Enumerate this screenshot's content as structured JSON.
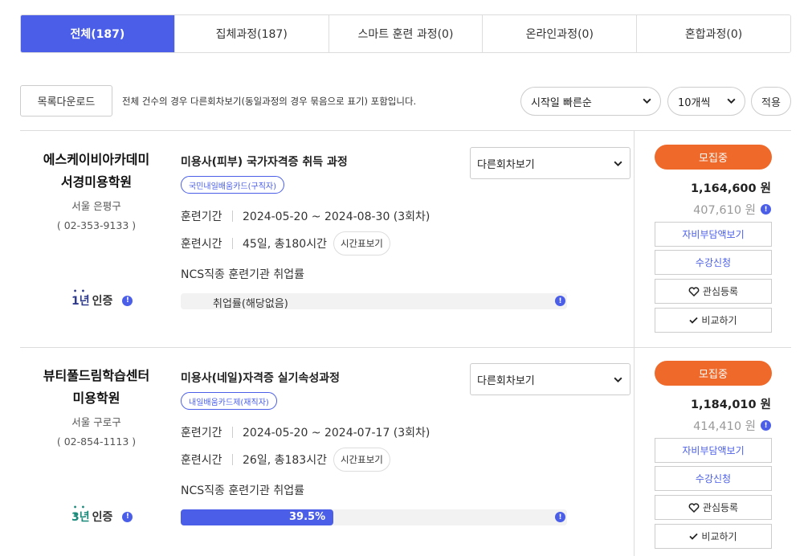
{
  "tabs": [
    {
      "label": "전체(187)",
      "active": true
    },
    {
      "label": "집체과정(187)",
      "active": false
    },
    {
      "label": "스마트 훈련 과정(0)",
      "active": false
    },
    {
      "label": "온라인과정(0)",
      "active": false
    },
    {
      "label": "혼합과정(0)",
      "active": false
    }
  ],
  "toolbar": {
    "download_label": "목록다운로드",
    "note": "전체 건수의 경우 다른회차보기(동일과정의 경우 묶음으로 표기) 포함입니다.",
    "sort_value": "시작일 빠른순",
    "count_value": "10개씩",
    "apply_label": "적용"
  },
  "courses": [
    {
      "inst_line1": "에스케이비아카데미",
      "inst_line2": "서경미용학원",
      "location": "서울 은평구",
      "tel": "( 02-353-9133 )",
      "cert_years": "1년",
      "cert_label": "인증",
      "title": "미용사(피부) 국가자격증 취득 과정",
      "badge": "국민내일배움카드(구직자)",
      "rerun": "다른회차보기",
      "period_label": "훈련기간",
      "period": "2024-05-20 ~ 2024-08-30 (3회차)",
      "time_label": "훈련시간",
      "time": "45일, 총180시간",
      "timetable": "시간표보기",
      "ncs": "NCS직종 훈련기관 취업률",
      "rate_text": "취업률(해당없음)",
      "rate": 0,
      "status": "모집중",
      "price": "1,164,600 원",
      "self_pay": "407,610 원",
      "btn_self": "자비부담액보기",
      "btn_apply": "수강신청",
      "btn_fav": "관심등록",
      "btn_compare": "비교하기"
    },
    {
      "inst_line1": "뷰티풀드림학습센터",
      "inst_line2": "미용학원",
      "location": "서울 구로구",
      "tel": "( 02-854-1113 )",
      "cert_years": "3년",
      "cert_label": "인증",
      "title": "미용사(네일)자격증 실기속성과정",
      "badge": "내일배움카드제(재직자)",
      "rerun": "다른회차보기",
      "period_label": "훈련기간",
      "period": "2024-05-20 ~ 2024-07-17 (3회차)",
      "time_label": "훈련시간",
      "time": "26일, 총183시간",
      "timetable": "시간표보기",
      "ncs": "NCS직종 훈련기관 취업률",
      "rate_text": "39.5%",
      "rate": 39.5,
      "status": "모집중",
      "price": "1,184,010 원",
      "self_pay": "414,410 원",
      "btn_self": "자비부담액보기",
      "btn_apply": "수강신청",
      "btn_fav": "관심등록",
      "btn_compare": "비교하기"
    }
  ],
  "colors": {
    "accent": "#4a5ee8",
    "status": "#ef6a2a",
    "cert1": "#2e3a8c",
    "cert3": "#1a8a7a"
  }
}
